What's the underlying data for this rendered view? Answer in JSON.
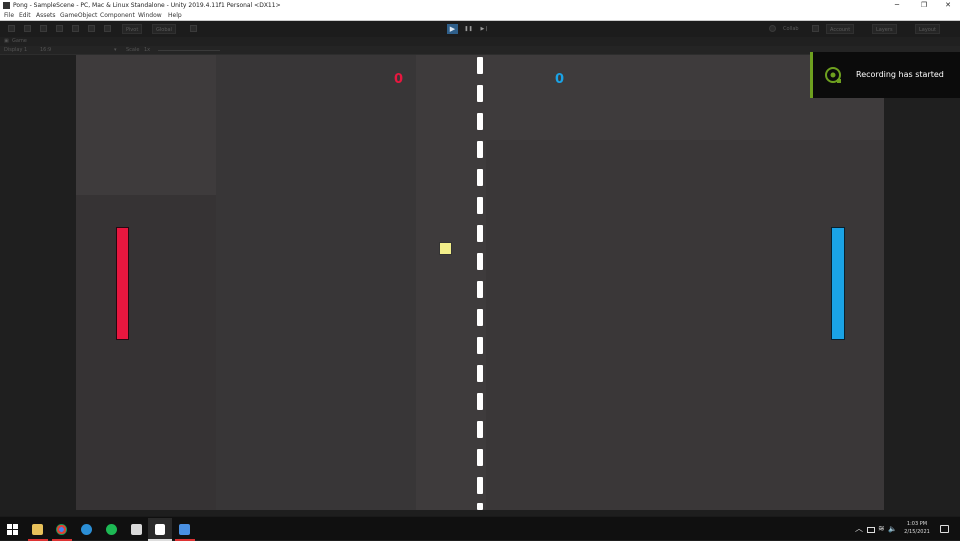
{
  "window": {
    "title": "Pong - SampleScene - PC, Mac & Linux Standalone - Unity 2019.4.11f1 Personal <DX11>",
    "minimize_glyph": "─",
    "maximize_glyph": "❐",
    "close_glyph": "✕"
  },
  "menu": [
    "File",
    "Edit",
    "Assets",
    "GameObject",
    "Component",
    "Window",
    "Help"
  ],
  "toolbar": {
    "pivot_label": "Pivot",
    "global_label": "Global",
    "play_glyph": "▶",
    "pause_glyph": "❚❚",
    "step_glyph": "▶❘",
    "collab_label": "Collab",
    "account_label": "Account",
    "layers_label": "Layers",
    "layout_label": "Layout"
  },
  "panels": {
    "tab_label": "Game",
    "display_label": "Display 1",
    "aspect_label": "16:9",
    "scale_label": "Scale",
    "scale_value": "1x"
  },
  "game": {
    "left_score": "0",
    "right_score": "0",
    "left_color": "#e8173f",
    "right_color": "#1aa3e6",
    "ball_color": "#f2ee8a",
    "court_color": "#3e3b3c"
  },
  "notification": {
    "text": "Recording has started",
    "icon": "xbox-game-bar-icon",
    "accent": "#6ea01f"
  },
  "taskbar": {
    "apps": [
      "windows-start-icon",
      "file-explorer-icon",
      "chrome-icon",
      "edge-icon",
      "spotify-icon",
      "folder-icon",
      "unity-icon",
      "visual-studio-icon"
    ],
    "tray": {
      "chevron_glyph": "︿",
      "wifi_glyph": "≋",
      "volume_glyph": "🔈"
    },
    "time": "1:03 PM",
    "date": "2/15/2021"
  }
}
